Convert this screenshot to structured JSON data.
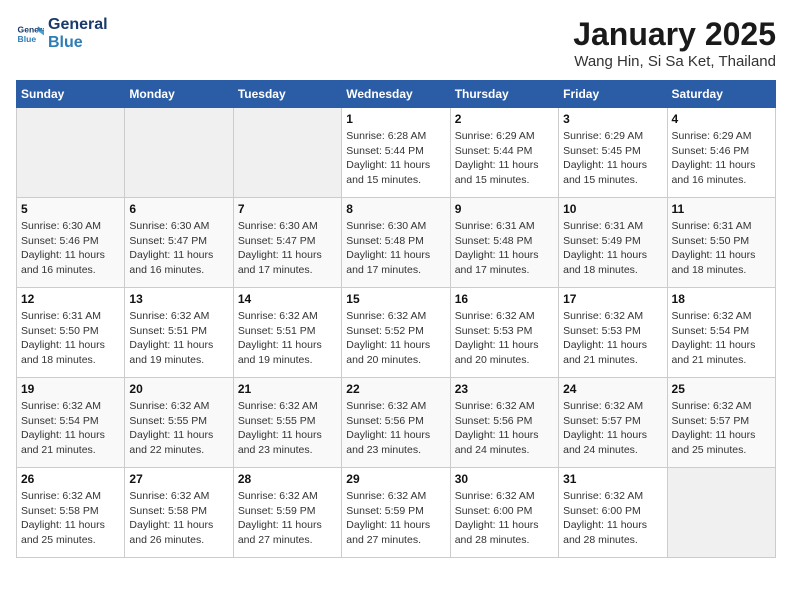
{
  "logo": {
    "line1": "General",
    "line2": "Blue"
  },
  "title": "January 2025",
  "subtitle": "Wang Hin, Si Sa Ket, Thailand",
  "days_of_week": [
    "Sunday",
    "Monday",
    "Tuesday",
    "Wednesday",
    "Thursday",
    "Friday",
    "Saturday"
  ],
  "weeks": [
    [
      {
        "day": "",
        "info": ""
      },
      {
        "day": "",
        "info": ""
      },
      {
        "day": "",
        "info": ""
      },
      {
        "day": "1",
        "info": "Sunrise: 6:28 AM\nSunset: 5:44 PM\nDaylight: 11 hours and 15 minutes."
      },
      {
        "day": "2",
        "info": "Sunrise: 6:29 AM\nSunset: 5:44 PM\nDaylight: 11 hours and 15 minutes."
      },
      {
        "day": "3",
        "info": "Sunrise: 6:29 AM\nSunset: 5:45 PM\nDaylight: 11 hours and 15 minutes."
      },
      {
        "day": "4",
        "info": "Sunrise: 6:29 AM\nSunset: 5:46 PM\nDaylight: 11 hours and 16 minutes."
      }
    ],
    [
      {
        "day": "5",
        "info": "Sunrise: 6:30 AM\nSunset: 5:46 PM\nDaylight: 11 hours and 16 minutes."
      },
      {
        "day": "6",
        "info": "Sunrise: 6:30 AM\nSunset: 5:47 PM\nDaylight: 11 hours and 16 minutes."
      },
      {
        "day": "7",
        "info": "Sunrise: 6:30 AM\nSunset: 5:47 PM\nDaylight: 11 hours and 17 minutes."
      },
      {
        "day": "8",
        "info": "Sunrise: 6:30 AM\nSunset: 5:48 PM\nDaylight: 11 hours and 17 minutes."
      },
      {
        "day": "9",
        "info": "Sunrise: 6:31 AM\nSunset: 5:48 PM\nDaylight: 11 hours and 17 minutes."
      },
      {
        "day": "10",
        "info": "Sunrise: 6:31 AM\nSunset: 5:49 PM\nDaylight: 11 hours and 18 minutes."
      },
      {
        "day": "11",
        "info": "Sunrise: 6:31 AM\nSunset: 5:50 PM\nDaylight: 11 hours and 18 minutes."
      }
    ],
    [
      {
        "day": "12",
        "info": "Sunrise: 6:31 AM\nSunset: 5:50 PM\nDaylight: 11 hours and 18 minutes."
      },
      {
        "day": "13",
        "info": "Sunrise: 6:32 AM\nSunset: 5:51 PM\nDaylight: 11 hours and 19 minutes."
      },
      {
        "day": "14",
        "info": "Sunrise: 6:32 AM\nSunset: 5:51 PM\nDaylight: 11 hours and 19 minutes."
      },
      {
        "day": "15",
        "info": "Sunrise: 6:32 AM\nSunset: 5:52 PM\nDaylight: 11 hours and 20 minutes."
      },
      {
        "day": "16",
        "info": "Sunrise: 6:32 AM\nSunset: 5:53 PM\nDaylight: 11 hours and 20 minutes."
      },
      {
        "day": "17",
        "info": "Sunrise: 6:32 AM\nSunset: 5:53 PM\nDaylight: 11 hours and 21 minutes."
      },
      {
        "day": "18",
        "info": "Sunrise: 6:32 AM\nSunset: 5:54 PM\nDaylight: 11 hours and 21 minutes."
      }
    ],
    [
      {
        "day": "19",
        "info": "Sunrise: 6:32 AM\nSunset: 5:54 PM\nDaylight: 11 hours and 21 minutes."
      },
      {
        "day": "20",
        "info": "Sunrise: 6:32 AM\nSunset: 5:55 PM\nDaylight: 11 hours and 22 minutes."
      },
      {
        "day": "21",
        "info": "Sunrise: 6:32 AM\nSunset: 5:55 PM\nDaylight: 11 hours and 23 minutes."
      },
      {
        "day": "22",
        "info": "Sunrise: 6:32 AM\nSunset: 5:56 PM\nDaylight: 11 hours and 23 minutes."
      },
      {
        "day": "23",
        "info": "Sunrise: 6:32 AM\nSunset: 5:56 PM\nDaylight: 11 hours and 24 minutes."
      },
      {
        "day": "24",
        "info": "Sunrise: 6:32 AM\nSunset: 5:57 PM\nDaylight: 11 hours and 24 minutes."
      },
      {
        "day": "25",
        "info": "Sunrise: 6:32 AM\nSunset: 5:57 PM\nDaylight: 11 hours and 25 minutes."
      }
    ],
    [
      {
        "day": "26",
        "info": "Sunrise: 6:32 AM\nSunset: 5:58 PM\nDaylight: 11 hours and 25 minutes."
      },
      {
        "day": "27",
        "info": "Sunrise: 6:32 AM\nSunset: 5:58 PM\nDaylight: 11 hours and 26 minutes."
      },
      {
        "day": "28",
        "info": "Sunrise: 6:32 AM\nSunset: 5:59 PM\nDaylight: 11 hours and 27 minutes."
      },
      {
        "day": "29",
        "info": "Sunrise: 6:32 AM\nSunset: 5:59 PM\nDaylight: 11 hours and 27 minutes."
      },
      {
        "day": "30",
        "info": "Sunrise: 6:32 AM\nSunset: 6:00 PM\nDaylight: 11 hours and 28 minutes."
      },
      {
        "day": "31",
        "info": "Sunrise: 6:32 AM\nSunset: 6:00 PM\nDaylight: 11 hours and 28 minutes."
      },
      {
        "day": "",
        "info": ""
      }
    ]
  ]
}
